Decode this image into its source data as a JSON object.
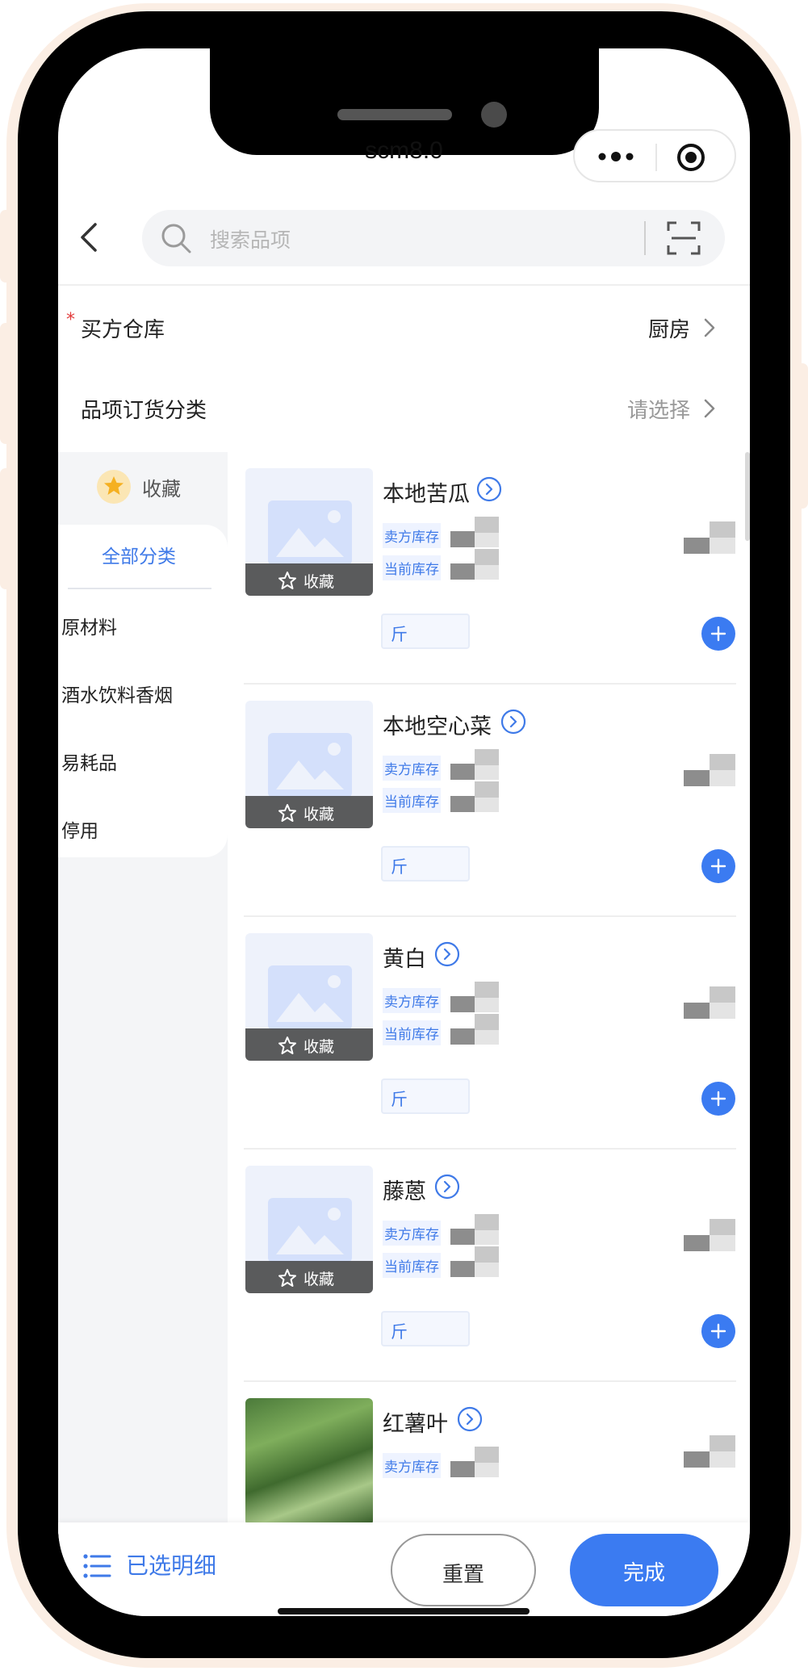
{
  "header": {
    "title": "scm8.0"
  },
  "search": {
    "placeholder": "搜索品项"
  },
  "form": {
    "warehouse_label": "买方仓库",
    "warehouse_required": "*",
    "warehouse_value": "厨房",
    "category_label": "品项订货分类",
    "category_value": "请选择"
  },
  "sidebar": {
    "favorites_label": "收藏",
    "all_label": "全部分类",
    "categories": [
      "原材料",
      "酒水饮料香烟",
      "易耗品",
      "停用"
    ]
  },
  "products": [
    {
      "name": "本地苦瓜",
      "seller_stock_label": "卖方库存",
      "current_stock_label": "当前库存",
      "unit": "斤",
      "favorite_label": "收藏",
      "has_photo": false
    },
    {
      "name": "本地空心菜",
      "seller_stock_label": "卖方库存",
      "current_stock_label": "当前库存",
      "unit": "斤",
      "favorite_label": "收藏",
      "has_photo": false
    },
    {
      "name": "黄白",
      "seller_stock_label": "卖方库存",
      "current_stock_label": "当前库存",
      "unit": "斤",
      "favorite_label": "收藏",
      "has_photo": false
    },
    {
      "name": "藤蒽",
      "seller_stock_label": "卖方库存",
      "current_stock_label": "当前库存",
      "unit": "斤",
      "favorite_label": "收藏",
      "has_photo": false
    },
    {
      "name": "红薯叶",
      "seller_stock_label": "卖方库存",
      "has_photo": true
    }
  ],
  "bottom": {
    "detail_label": "已选明细",
    "reset_label": "重置",
    "done_label": "完成"
  },
  "colors": {
    "accent": "#3b7bf1",
    "link_blue": "#3f7ae8",
    "required": "#e23b3b",
    "frame": "#fbeee4"
  },
  "icons": [
    "more-icon",
    "target-icon",
    "back-icon",
    "search-icon",
    "scan-icon",
    "chevron-right-icon",
    "star-icon",
    "image-placeholder-icon",
    "info-circle-icon",
    "plus-icon",
    "list-icon"
  ]
}
